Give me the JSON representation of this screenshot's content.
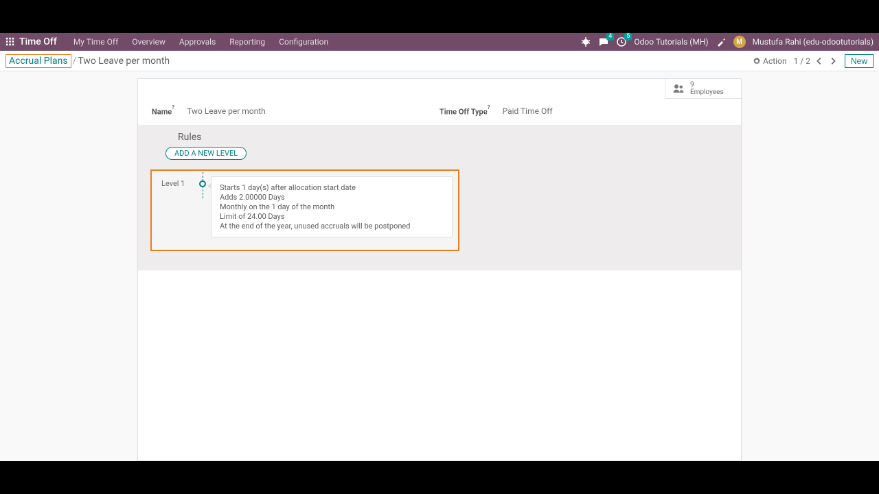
{
  "app": {
    "title": "Time Off"
  },
  "nav": {
    "items": [
      "My Time Off",
      "Overview",
      "Approvals",
      "Reporting",
      "Configuration"
    ]
  },
  "topright": {
    "chat_badge": "4",
    "activity_badge": "5",
    "company": "Odoo Tutorials (MH)",
    "avatar_letter": "M",
    "user": "Mustufa Rahi (edu-odootutorials)"
  },
  "breadcrumb": {
    "root": "Accrual Plans",
    "sep": "/",
    "current": "Two Leave per month"
  },
  "controlpanel": {
    "action_label": "Action",
    "pager": "1 / 2",
    "new_label": "New"
  },
  "stat": {
    "count": "9",
    "label": "Employees"
  },
  "fields": {
    "name_label": "Name",
    "name_sup": "?",
    "name_value": "Two Leave per month",
    "type_label": "Time Off Type",
    "type_sup": "?",
    "type_value": "Paid Time Off"
  },
  "rules": {
    "heading": "Rules",
    "add_label": "ADD A NEW LEVEL",
    "levels": [
      {
        "title": "Level 1",
        "lines": [
          "Starts 1 day(s) after allocation start date",
          "Adds 2.00000 Days",
          "Monthly on the 1 day of the month",
          "Limit of 24.00 Days",
          "At the end of the year, unused accruals will be postponed"
        ]
      }
    ]
  }
}
